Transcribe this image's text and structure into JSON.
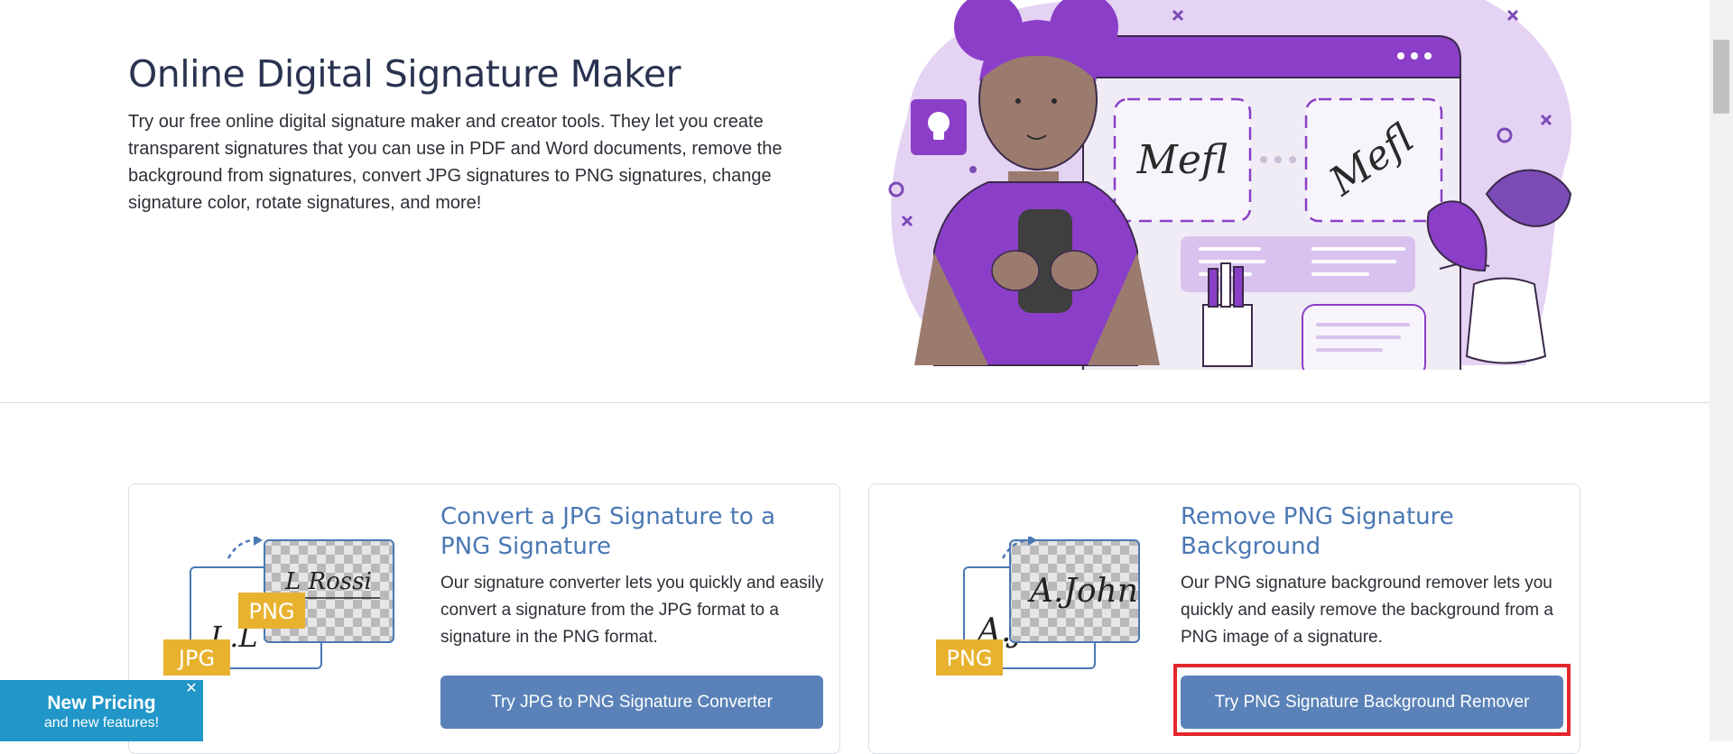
{
  "hero": {
    "title": "Online Digital Signature Maker",
    "description": "Try our free online digital signature maker and creator tools. They let you create transparent signatures that you can use in PDF and Word documents, remove the background from signatures, convert JPG signatures to PNG signatures, change signature color, rotate signatures, and more!",
    "illustration": {
      "signature_text_1": "Mefl",
      "signature_text_2": "Mefl",
      "icon": "lightbulb-icon"
    }
  },
  "cards": [
    {
      "title": "Convert a JPG Signature to a PNG Signature",
      "description": "Our signature converter lets you quickly and easily convert a signature from the JPG format to a signature in the PNG format.",
      "button": "Try JPG to PNG Signature Converter",
      "illustration": {
        "badge_front": "JPG",
        "badge_back": "PNG",
        "signature_front": "L.L",
        "signature_back": "L Rossi"
      }
    },
    {
      "title": "Remove PNG Signature Background",
      "description": "Our PNG signature background remover lets you quickly and easily remove the background from a PNG image of a signature.",
      "button": "Try PNG Signature Background Remover",
      "illustration": {
        "badge_front": "PNG",
        "signature_front": "A.J",
        "signature_back": "A.John"
      }
    }
  ],
  "promo": {
    "title": "New Pricing",
    "subtitle": "and new features!",
    "close_symbol": "✕"
  },
  "colors": {
    "accent": "#8b3fc8",
    "button": "#5a82b8",
    "card_title": "#4b78b4",
    "promo": "#2196c9",
    "badge": "#e8b22f",
    "highlight": "#e2262b"
  }
}
